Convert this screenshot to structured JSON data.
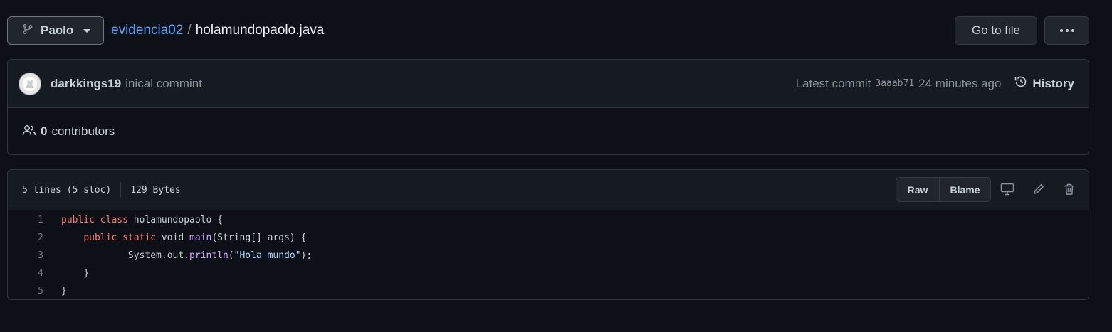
{
  "branch": {
    "name": "Paolo"
  },
  "breadcrumb": {
    "repo": "evidencia02",
    "separator": "/",
    "file": "holamundopaolo.java"
  },
  "actions": {
    "goto_file": "Go to file"
  },
  "commit": {
    "author": "darkkings19",
    "message": "inical commint",
    "latest_label": "Latest commit",
    "sha": "3aaab71",
    "time": "24 minutes ago",
    "history_label": "History"
  },
  "contributors": {
    "count": "0",
    "label": "contributors"
  },
  "file": {
    "lines_info": "5 lines (5 sloc)",
    "size": "129 Bytes",
    "raw_label": "Raw",
    "blame_label": "Blame"
  },
  "code": {
    "lines": [
      {
        "n": "1",
        "indent": "",
        "tokens": [
          [
            "kw",
            "public"
          ],
          [
            "",
            ""
          ],
          [
            "kw",
            " class"
          ],
          [
            "",
            " holamundopaolo {"
          ]
        ]
      },
      {
        "n": "2",
        "indent": "    ",
        "tokens": [
          [
            "kw",
            "public"
          ],
          [
            "kw",
            " static"
          ],
          [
            "",
            " void "
          ],
          [
            "fn",
            "main"
          ],
          [
            "",
            "(String[] args) {"
          ]
        ]
      },
      {
        "n": "3",
        "indent": "            ",
        "tokens": [
          [
            "",
            "System.out."
          ],
          [
            "fn",
            "println"
          ],
          [
            "",
            "("
          ],
          [
            "str",
            "\"Hola mundo\""
          ],
          [
            "",
            ");"
          ]
        ]
      },
      {
        "n": "4",
        "indent": "    ",
        "tokens": [
          [
            "",
            "}"
          ]
        ]
      },
      {
        "n": "5",
        "indent": "",
        "tokens": [
          [
            "",
            "}"
          ]
        ]
      }
    ]
  },
  "colors": {
    "background": "#0d1117",
    "link": "#58a6ff",
    "keyword": "#ff7b72",
    "function": "#d2a8ff",
    "string": "#a5d6ff"
  }
}
